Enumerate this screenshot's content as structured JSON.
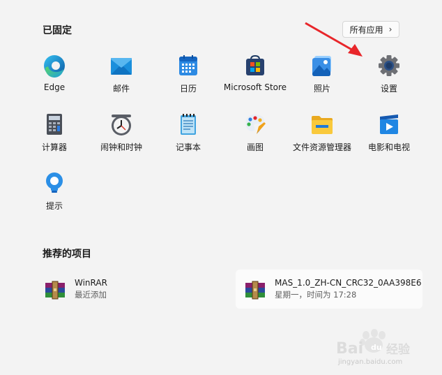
{
  "pinned": {
    "title": "已固定",
    "all_apps_label": "所有应用",
    "apps": [
      {
        "name": "edge",
        "label": "Edge",
        "icon": "edge-icon"
      },
      {
        "name": "mail",
        "label": "邮件",
        "icon": "mail-icon"
      },
      {
        "name": "calendar",
        "label": "日历",
        "icon": "calendar-icon"
      },
      {
        "name": "store",
        "label": "Microsoft Store",
        "icon": "store-icon"
      },
      {
        "name": "photos",
        "label": "照片",
        "icon": "photos-icon"
      },
      {
        "name": "settings",
        "label": "设置",
        "icon": "gear-icon"
      },
      {
        "name": "calculator",
        "label": "计算器",
        "icon": "calculator-icon"
      },
      {
        "name": "clock",
        "label": "闹钟和时钟",
        "icon": "clock-icon"
      },
      {
        "name": "notepad",
        "label": "记事本",
        "icon": "notepad-icon"
      },
      {
        "name": "paint",
        "label": "画图",
        "icon": "paint-palette-icon"
      },
      {
        "name": "explorer",
        "label": "文件资源管理器",
        "icon": "folder-icon"
      },
      {
        "name": "movies",
        "label": "电影和电视",
        "icon": "play-icon"
      },
      {
        "name": "tips",
        "label": "提示",
        "icon": "lightbulb-icon"
      }
    ]
  },
  "recommended": {
    "title": "推荐的项目",
    "items": [
      {
        "name": "WinRAR",
        "subtitle": "最近添加",
        "icon": "winrar-icon"
      },
      {
        "name": "MAS_1.0_ZH-CN_CRC32_0AA398E6",
        "subtitle": "星期一，时间为 17:28",
        "icon": "winrar-archive-icon"
      }
    ]
  },
  "watermark": {
    "text": "Bai du 经验",
    "sub": "jingyan.baidu.com"
  },
  "colors": {
    "annotation_arrow": "#e8262a",
    "background": "#f3f3f3"
  }
}
